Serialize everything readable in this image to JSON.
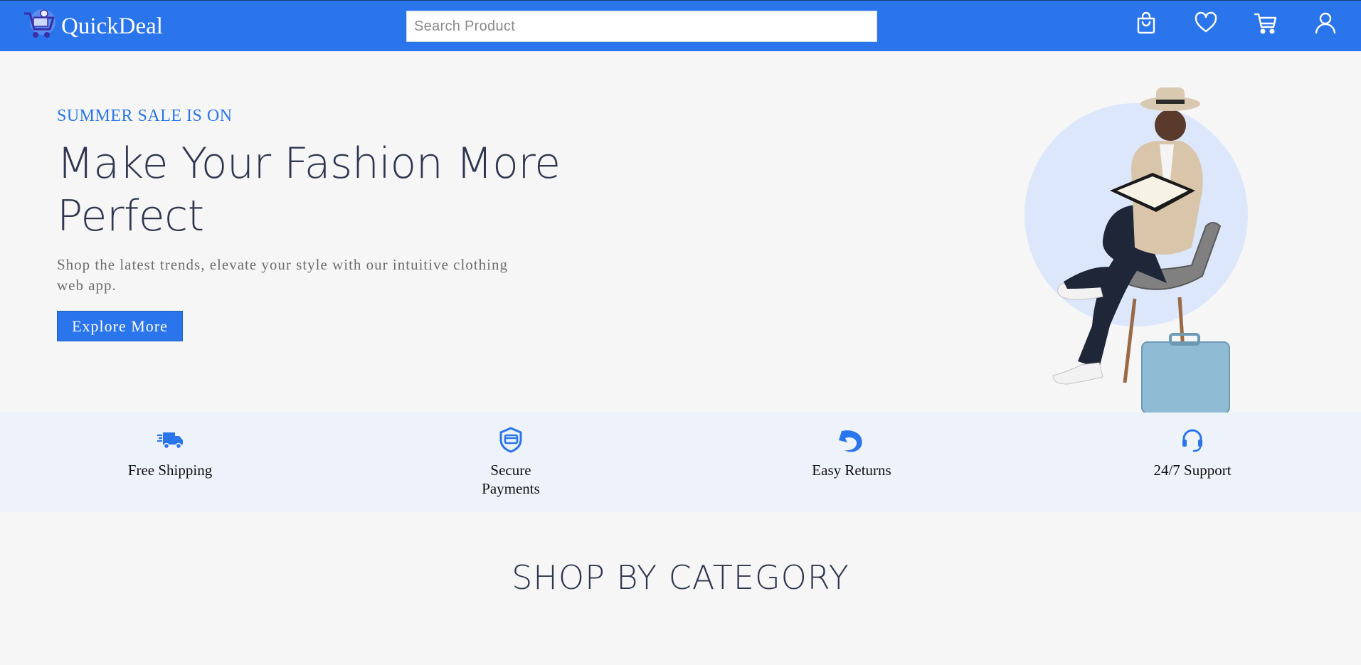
{
  "brand": {
    "name": "QuickDeal",
    "accent": "#2a75eb"
  },
  "search": {
    "placeholder": "Search Product",
    "value": ""
  },
  "nav_icons": [
    "shopping-bag-icon",
    "heart-icon",
    "cart-icon",
    "user-icon"
  ],
  "hero": {
    "kicker": "SUMMER SALE IS ON",
    "title": "Make Your Fashion More Perfect",
    "description": "Shop the latest trends, elevate your style with our intuitive clothing web app.",
    "cta_label": "Explore More"
  },
  "features": [
    {
      "icon": "delivery-truck-icon",
      "label": "Free Shipping"
    },
    {
      "icon": "secure-payment-icon",
      "label": "Secure Payments"
    },
    {
      "icon": "return-arrow-icon",
      "label": "Easy Returns"
    },
    {
      "icon": "headset-icon",
      "label": "24/7 Support"
    }
  ],
  "sections": {
    "category_title": "SHOP BY CATEGORY"
  }
}
